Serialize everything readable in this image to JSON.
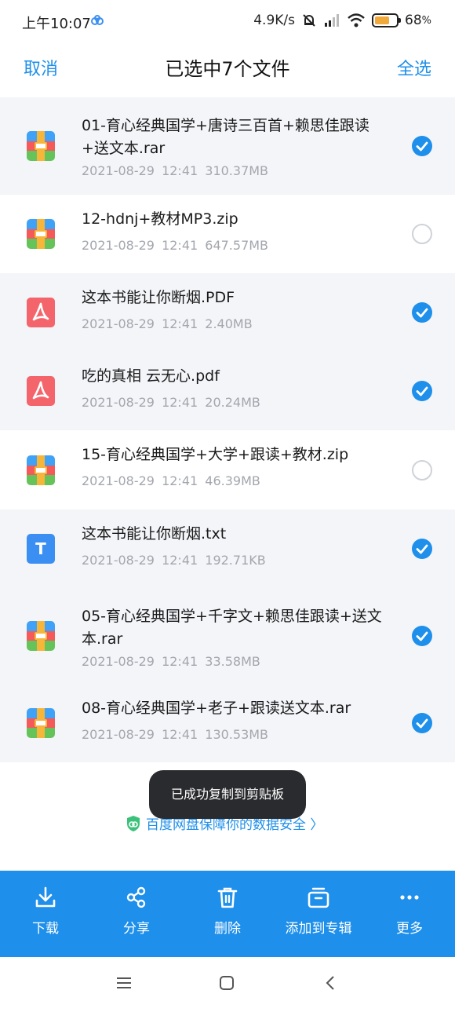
{
  "status_bar": {
    "time": "上午10:07",
    "net_speed": "4.9K/s",
    "battery_percent": "68",
    "battery_level": 0.68
  },
  "header": {
    "cancel": "取消",
    "title": "已选中7个文件",
    "select_all": "全选"
  },
  "files": [
    {
      "name": "01-育心经典国学+唐诗三百首+赖思佳跟读+送文本.rar",
      "meta": "2021-08-29 12:41 310.37MB",
      "icon": "archive-icon",
      "selected": true
    },
    {
      "name": "12-hdnj+教材MP3.zip",
      "meta": "2021-08-29 12:41 647.57MB",
      "icon": "archive-icon",
      "selected": false
    },
    {
      "name": "这本书能让你断烟.PDF",
      "meta": "2021-08-29 12:41 2.40MB",
      "icon": "pdf-icon",
      "selected": true
    },
    {
      "name": "吃的真相 云无心.pdf",
      "meta": "2021-08-29 12:41 20.24MB",
      "icon": "pdf-icon",
      "selected": true
    },
    {
      "name": "15-育心经典国学+大学+跟读+教材.zip",
      "meta": "2021-08-29 12:41 46.39MB",
      "icon": "archive-icon",
      "selected": false
    },
    {
      "name": "这本书能让你断烟.txt",
      "meta": "2021-08-29 12:41 192.71KB",
      "icon": "txt-icon",
      "selected": true
    },
    {
      "name": "05-育心经典国学+千字文+赖思佳跟读+送文本.rar",
      "meta": "2021-08-29 12:41 33.58MB",
      "icon": "archive-icon",
      "selected": true
    },
    {
      "name": "08-育心经典国学+老子+跟读送文本.rar",
      "meta": "2021-08-29 12:41 130.53MB",
      "icon": "archive-icon",
      "selected": true
    }
  ],
  "security_notice": "百度网盘保障你的数据安全 〉",
  "toast": "已成功复制到剪贴板",
  "txt_icon_letter": "T",
  "actions": [
    {
      "label": "下载",
      "icon": "download-icon"
    },
    {
      "label": "分享",
      "icon": "share-icon"
    },
    {
      "label": "删除",
      "icon": "trash-icon"
    },
    {
      "label": "添加到专辑",
      "icon": "album-icon"
    },
    {
      "label": "更多",
      "icon": "more-icon"
    }
  ],
  "colors": {
    "accent": "#1e8fea",
    "selected_row_bg": "#f4f5f9",
    "toast_bg": "#2a2b2e"
  }
}
